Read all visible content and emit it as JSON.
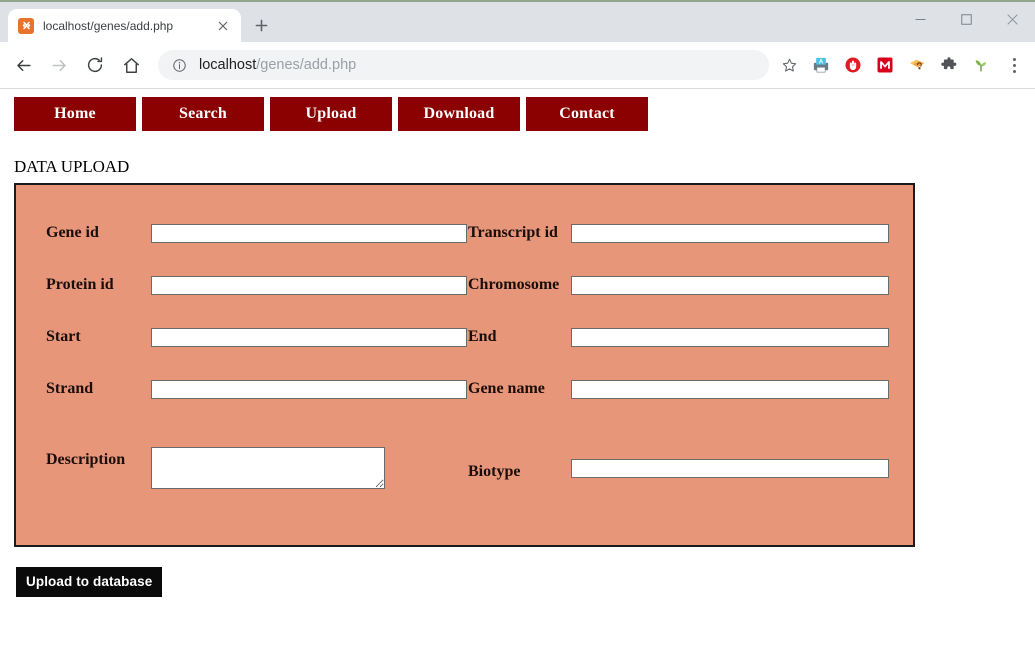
{
  "browser": {
    "tab": {
      "title": "localhost/genes/add.php",
      "favicon_name": "xampp-favicon",
      "close_label": "✕"
    },
    "newtab_label": "New tab",
    "window_controls": {
      "minimize": "minimize",
      "maximize": "maximize",
      "close": "close"
    },
    "toolbar": {
      "back": "Back",
      "forward": "Forward",
      "reload": "Reload",
      "home": "Home",
      "bookmark": "Bookmark this page",
      "menu": "Customize and control Google Chrome"
    },
    "omnibox": {
      "url_host": "localhost",
      "url_path": "/genes/add.php",
      "full_url": "localhost/genes/add.php",
      "security_icon": "info-circle-icon"
    },
    "extensions": [
      {
        "name": "screenshot-extension-icon",
        "color": "#4aa3df"
      },
      {
        "name": "adblock-extension-icon",
        "color": "#e01b24"
      },
      {
        "name": "mega-extension-icon",
        "color": "#d9001b"
      },
      {
        "name": "honey-extension-icon",
        "color": "#f0a020"
      },
      {
        "name": "puzzle-extensions-icon",
        "color": "#5f6368"
      },
      {
        "name": "grammarly-extension-icon",
        "color": "#7cb342"
      }
    ]
  },
  "page": {
    "nav": [
      {
        "label": "Home"
      },
      {
        "label": "Search"
      },
      {
        "label": "Upload"
      },
      {
        "label": "Download"
      },
      {
        "label": "Contact"
      }
    ],
    "heading": "DATA UPLOAD",
    "panel_color": "#e8967a",
    "nav_color": "#8b0000",
    "form": {
      "rows": [
        {
          "left": {
            "label": "Gene id",
            "value": "",
            "placeholder": "",
            "type": "text"
          },
          "right": {
            "label": "Transcript id",
            "value": "",
            "placeholder": "",
            "type": "text"
          }
        },
        {
          "left": {
            "label": "Protein id",
            "value": "",
            "placeholder": "",
            "type": "text"
          },
          "right": {
            "label": "Chromosome",
            "value": "",
            "placeholder": "",
            "type": "text"
          }
        },
        {
          "left": {
            "label": "Start",
            "value": "",
            "placeholder": "",
            "type": "text"
          },
          "right": {
            "label": "End",
            "value": "",
            "placeholder": "",
            "type": "text"
          }
        },
        {
          "left": {
            "label": "Strand",
            "value": "",
            "placeholder": "",
            "type": "text"
          },
          "right": {
            "label": "Gene name",
            "value": "",
            "placeholder": "",
            "type": "text"
          }
        }
      ],
      "description": {
        "label": "Description",
        "value": "",
        "placeholder": "",
        "type": "textarea"
      },
      "biotype": {
        "label": "Biotype",
        "value": "",
        "placeholder": "",
        "type": "text"
      },
      "submit_label": "Upload to database"
    }
  }
}
